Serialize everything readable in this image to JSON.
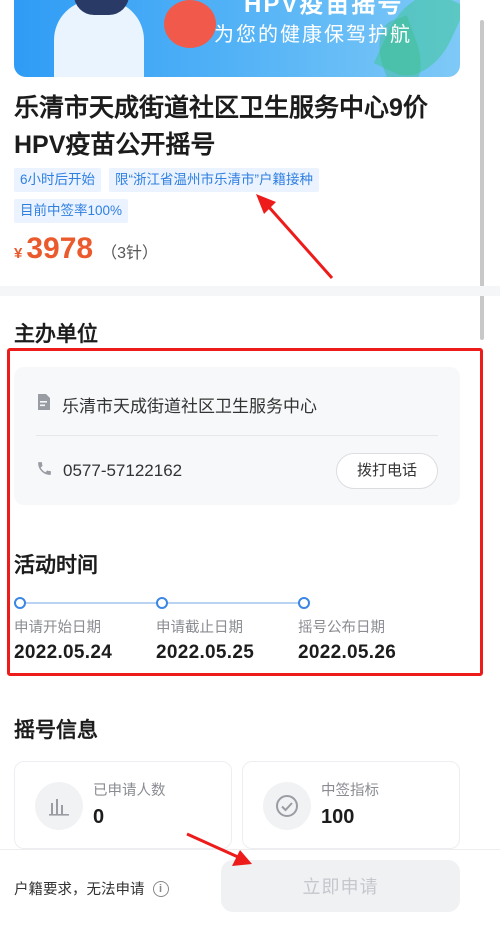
{
  "banner": {
    "top_text": "HPV疫苗摇号",
    "slogan": "为您的健康保驾护航"
  },
  "event": {
    "title": "乐清市天成街道社区卫生服务中心9价HPV疫苗公开摇号",
    "tags": [
      "6小时后开始",
      "限“浙江省温州市乐清市”户籍接种",
      "目前中签率100%"
    ],
    "price_symbol": "¥",
    "price": "3978",
    "price_unit": "（3针）"
  },
  "organizer": {
    "section_title": "主办单位",
    "name": "乐清市天成街道社区卫生服务中心",
    "phone": "0577-57122162",
    "call_label": "拨打电话"
  },
  "activity": {
    "section_title": "活动时间",
    "steps": [
      {
        "label": "申请开始日期",
        "date": "2022.05.24"
      },
      {
        "label": "申请截止日期",
        "date": "2022.05.25"
      },
      {
        "label": "摇号公布日期",
        "date": "2022.05.26"
      }
    ]
  },
  "lottery": {
    "section_title": "摇号信息",
    "stats": [
      {
        "label": "已申请人数",
        "value": "0",
        "icon": "bar-chart-icon"
      },
      {
        "label": "中签指标",
        "value": "100",
        "icon": "check-circle-icon"
      }
    ]
  },
  "footer": {
    "note": "户籍要求，无法申请",
    "apply_label": "立即申请"
  },
  "colors": {
    "accent": "#3b86e4",
    "price": "#ea5a2c",
    "annotation": "#ee1b1b"
  }
}
